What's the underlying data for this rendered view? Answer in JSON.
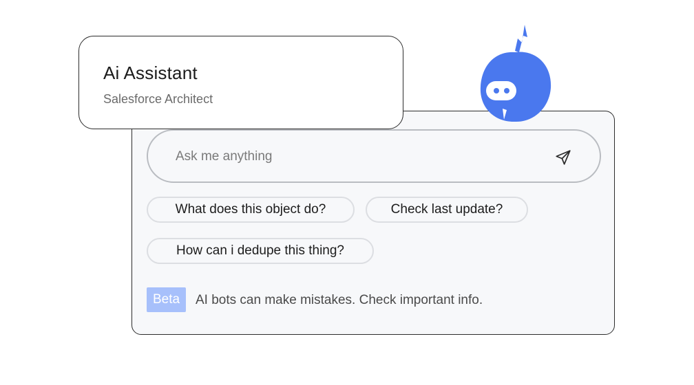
{
  "header": {
    "title": "Ai Assistant",
    "subtitle": "Salesforce Architect"
  },
  "ask": {
    "placeholder": "Ask me anything",
    "send_icon": "send-icon"
  },
  "suggestions": [
    {
      "label": "What does this object do?"
    },
    {
      "label": "Check last update?"
    },
    {
      "label": "How can i dedupe this thing?"
    }
  ],
  "footer": {
    "badge": "Beta",
    "disclaimer": "AI bots can make mistakes. Check important info."
  },
  "mascot": {
    "icon": "robot-mascot-icon",
    "color": "#4A78EE"
  },
  "colors": {
    "accent": "#4A78EE",
    "badge_bg": "#A7C0FB",
    "panel_bg": "#F7F8FA"
  }
}
